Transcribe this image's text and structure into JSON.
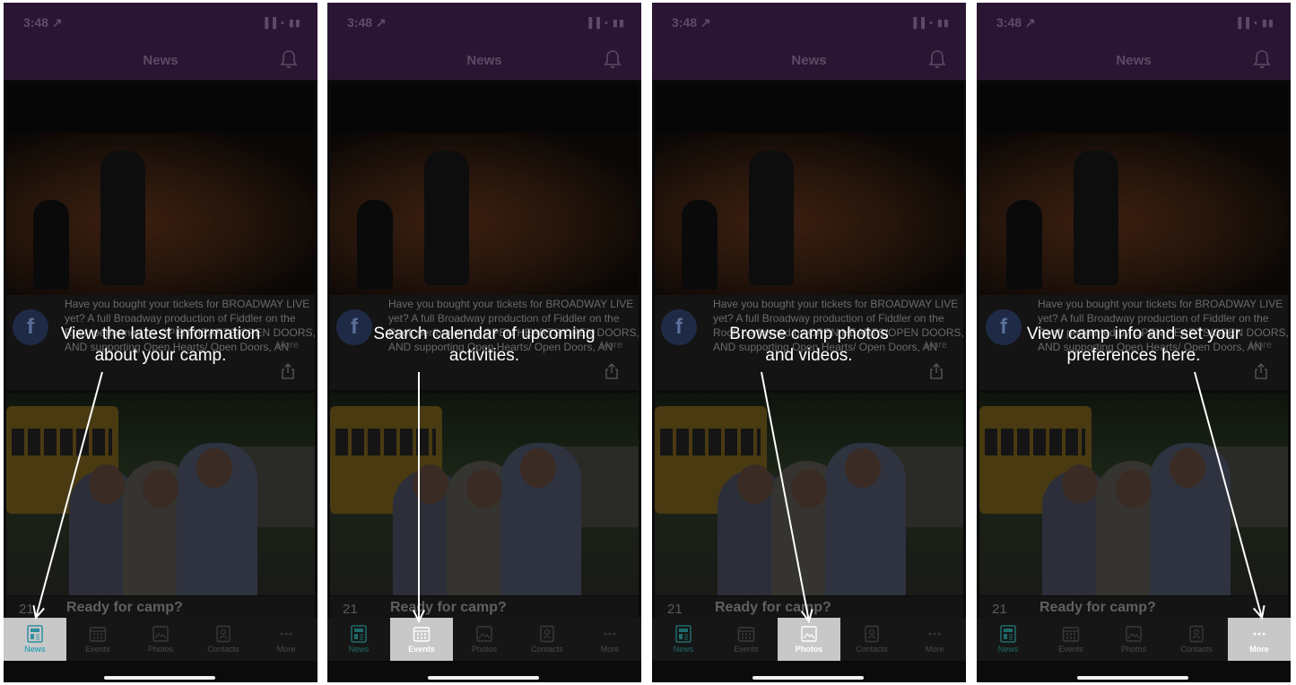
{
  "status": {
    "time": "3:48",
    "time_arrow": "↗",
    "indicators": "▐▐ • ▮▮"
  },
  "header": {
    "title": "News"
  },
  "post": {
    "text": "Have you bought your tickets for BROADWAY LIVE yet?  A full Broadway production of Fiddler on the Roof, performed by OPEN HEARTS/OPEN DOORS, AND supporting Open Hearts/ Open Doors, AN",
    "more": "More"
  },
  "event": {
    "day": "21",
    "title": "Ready for camp?"
  },
  "tabs": [
    {
      "label": "News",
      "icon": "news-icon"
    },
    {
      "label": "Events",
      "icon": "calendar-icon"
    },
    {
      "label": "Photos",
      "icon": "photos-icon"
    },
    {
      "label": "Contacts",
      "icon": "contacts-icon"
    },
    {
      "label": "More",
      "icon": "more-icon"
    }
  ],
  "panels": [
    {
      "callout": [
        "View the latest information",
        "about your camp."
      ],
      "highlighted_tab": "News"
    },
    {
      "callout": [
        "Search calendar of upcoming",
        "activities."
      ],
      "highlighted_tab": "Events"
    },
    {
      "callout": [
        "Browse camp photos",
        "and videos."
      ],
      "highlighted_tab": "Photos"
    },
    {
      "callout": [
        "View camp info and set your",
        "preferences here."
      ],
      "highlighted_tab": "More"
    }
  ],
  "colors": {
    "header_bg": "#2a1633",
    "highlight_bg": "#c8c8c8",
    "active_tab": "#3aa6b8"
  }
}
